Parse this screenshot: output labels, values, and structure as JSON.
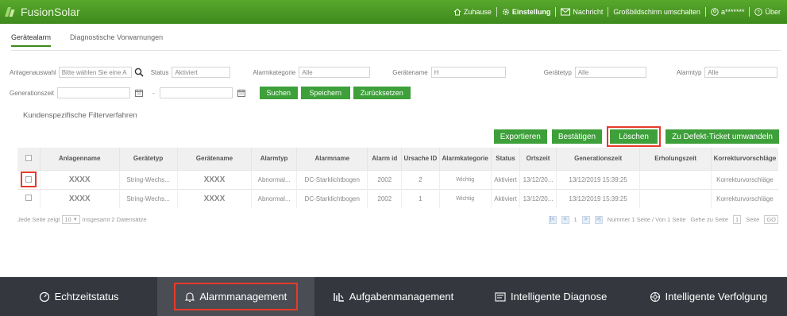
{
  "app": {
    "title": "FusionSolar"
  },
  "header": {
    "links": [
      {
        "icon": "home-icon",
        "label": "Zuhause"
      },
      {
        "icon": "gear-icon",
        "label": "Einstellung"
      },
      {
        "icon": "mail-icon",
        "label": "Nachricht"
      },
      {
        "icon": "",
        "label": "Großbildschirm umschalten"
      },
      {
        "icon": "user-icon",
        "label": "a*******"
      },
      {
        "icon": "help-icon",
        "label": "Über"
      }
    ]
  },
  "tabs": [
    {
      "label": "Gerätealarm",
      "active": true
    },
    {
      "label": "Diagnostische Vorwarnungen",
      "active": false
    }
  ],
  "filters": {
    "plant_label": "Anlagenauswahl",
    "plant_placeholder": "Bitte wählen Sie eine A",
    "status_label": "Status",
    "status_value": "Aktiviert",
    "category_label": "Alarmkategorie",
    "category_value": "Alle",
    "device_name_label": "Gerätename",
    "device_name_value": "H",
    "device_type_label": "Gerätetyp",
    "device_type_value": "Alle",
    "alarm_type_label": "Alarmtyp",
    "alarm_type_value": "Alle",
    "time_label": "Generationszeit",
    "date_sep": "-"
  },
  "buttons": {
    "search": "Suchen",
    "save": "Speichern",
    "reset": "Zurücksetzen",
    "export": "Exportieren",
    "confirm": "Bestätigen",
    "delete": "Löschen",
    "ticket": "Zu Defekt-Ticket umwandeln"
  },
  "custom_filter_label": "Kundenspezifische Filterverfahren",
  "table": {
    "headers": [
      "Anlagenname",
      "Gerätetyp",
      "Gerätename",
      "Alarmtyp",
      "Alarmname",
      "Alarm id",
      "Ursache ID",
      "Alarmkategorie",
      "Status",
      "Ortszeit",
      "Generationszeit",
      "Erholungszeit",
      "Korrekturvorschläge"
    ],
    "rows": [
      {
        "plant": "XXXX",
        "device_type": "String-Wechs...",
        "device_name": "XXXX",
        "alarm_type": "Abnormal...",
        "alarm_name": "DC-Starklichtbogen",
        "alarm_id": "2002",
        "cause_id": "2",
        "category": "Wichtig",
        "status": "Aktiviert",
        "local_time": "13/12/20...",
        "gen_time": "13/12/2019 15:39:25",
        "recovery": "",
        "suggestion": "Korrekturvorschläge"
      },
      {
        "plant": "XXXX",
        "device_type": "String-Wechs...",
        "device_name": "XXXX",
        "alarm_type": "Abnormal...",
        "alarm_name": "DC-Starklichtbogen",
        "alarm_id": "2002",
        "cause_id": "1",
        "category": "Wichtig",
        "status": "Aktiviert",
        "local_time": "13/12/20...",
        "gen_time": "13/12/2019 15:39:25",
        "recovery": "",
        "suggestion": "Korrekturvorschläge"
      }
    ]
  },
  "pager": {
    "per_page_label": "Jede Seite zeigt",
    "per_page": "10",
    "total": "Insgesamt 2 Datensätze",
    "current": "1",
    "info": "Nummer 1 Seite / Von 1 Seite",
    "goto_label": "Gehe zu Seite",
    "goto_value": "1",
    "goto_suffix": "Seite",
    "go": "GO"
  },
  "bottom_nav": [
    {
      "icon": "gauge-icon",
      "label": "Echtzeitstatus",
      "active": false
    },
    {
      "icon": "bell-icon",
      "label": "Alarmmanagement",
      "active": true
    },
    {
      "icon": "tasks-icon",
      "label": "Aufgabenmanagement",
      "active": false
    },
    {
      "icon": "diagnosis-icon",
      "label": "Intelligente Diagnose",
      "active": false
    },
    {
      "icon": "tracking-icon",
      "label": "Intelligente Verfolgung",
      "active": false
    }
  ],
  "colors": {
    "brand_green": "#3ea03a",
    "header_green": "#4a9a24",
    "highlight_red": "#e53a2a",
    "bottom_bar": "#34383e"
  }
}
